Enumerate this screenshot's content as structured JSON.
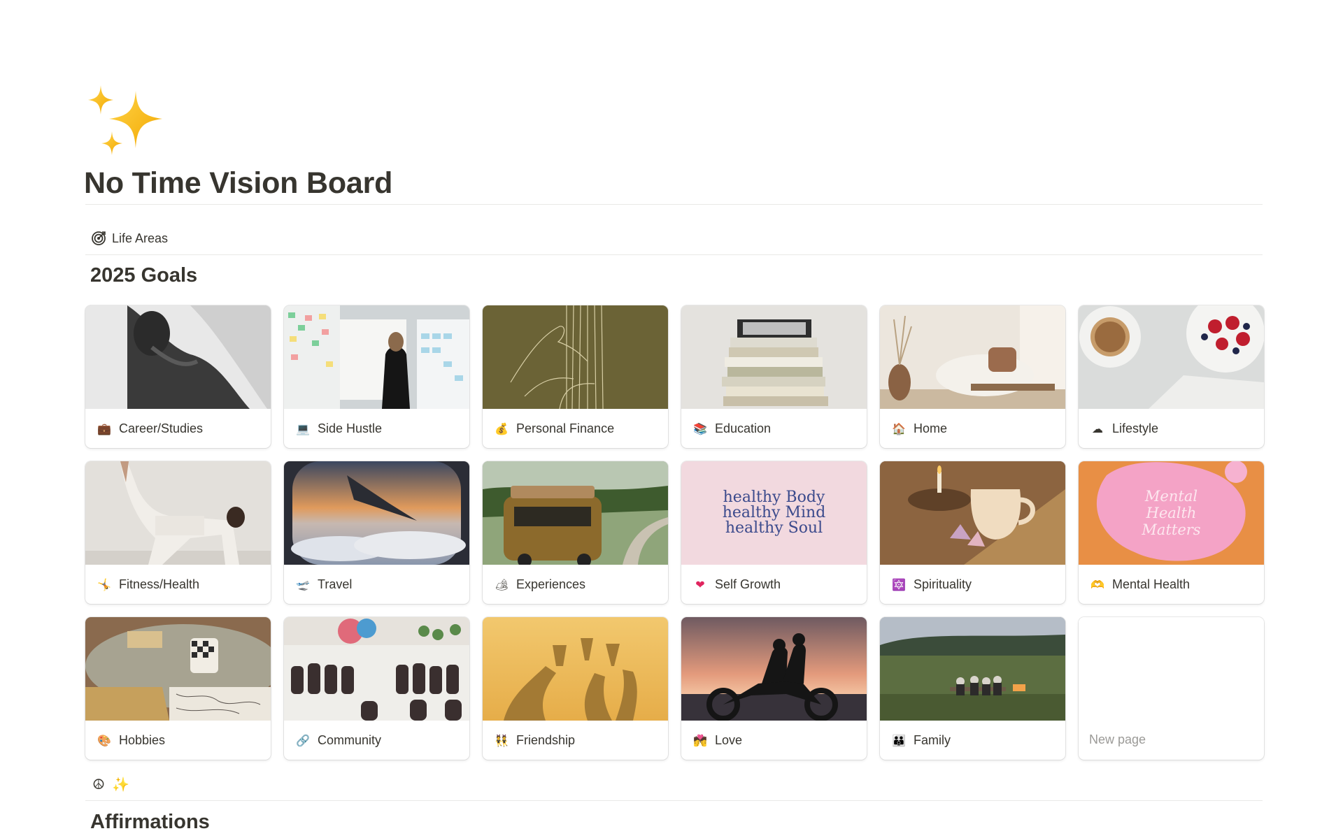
{
  "page": {
    "icon": "sparkles-icon",
    "title": "No Time Vision Board"
  },
  "life_areas_link": {
    "icon": "target-icon",
    "label": "Life Areas"
  },
  "goals_section": {
    "heading": "2025 Goals",
    "cards": [
      {
        "emoji": "💼",
        "label": "Career/Studies"
      },
      {
        "emoji": "💻",
        "label": "Side Hustle"
      },
      {
        "emoji": "💰",
        "label": "Personal Finance"
      },
      {
        "emoji": "📚",
        "label": "Education"
      },
      {
        "emoji": "🏠",
        "label": "Home"
      },
      {
        "emoji": "☁",
        "label": "Lifestyle"
      },
      {
        "emoji": "🤸",
        "label": "Fitness/Health"
      },
      {
        "emoji": "🛫",
        "label": "Travel"
      },
      {
        "emoji": "🏕",
        "label": "Experiences"
      },
      {
        "emoji": "❤",
        "label": "Self Growth"
      },
      {
        "emoji": "🔯",
        "label": "Spirituality"
      },
      {
        "emoji": "🫶",
        "label": "Mental Health"
      },
      {
        "emoji": "🎨",
        "label": "Hobbies"
      },
      {
        "emoji": "🔗",
        "label": "Community"
      },
      {
        "emoji": "👯",
        "label": "Friendship"
      },
      {
        "emoji": "💏",
        "label": "Love"
      },
      {
        "emoji": "👪",
        "label": "Family"
      }
    ],
    "new_page_label": "New page",
    "cover_texts": {
      "self_growth": [
        "healthy Body",
        "healthy Mind",
        "healthy Soul"
      ],
      "mental_health": [
        "Mental",
        "Health",
        "Matters"
      ]
    }
  },
  "bottom_icons": [
    "☮",
    "✨"
  ],
  "affirmations_section": {
    "heading": "Affirmations"
  },
  "colors": {
    "text": "#37352f",
    "muted": "#9b9a97",
    "divider": "#e9e9e7",
    "sparkle": "#f5b400"
  }
}
